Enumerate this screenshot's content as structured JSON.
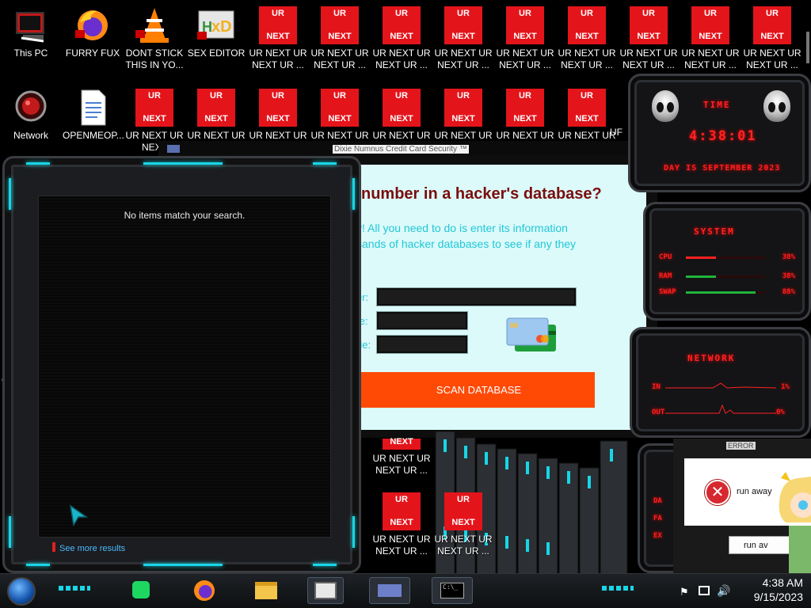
{
  "desktop": {
    "top_icons": [
      {
        "label": "This PC",
        "icon": "computer-icon"
      },
      {
        "label": "FURRY FUX",
        "icon": "firefox-icon"
      },
      {
        "label": "DONT STICK\nTHIS IN YO...",
        "icon": "vlc-cone-icon"
      },
      {
        "label": "SEX EDITOR",
        "icon": "hxd-editor-icon"
      }
    ],
    "second_icons": [
      {
        "label": "Network",
        "icon": "network-icon"
      },
      {
        "label": "OPENMEOP...",
        "icon": "document-icon"
      }
    ],
    "ur_tile": {
      "top": "UR",
      "bottom": "NEXT"
    },
    "ur_label_row1": "UR NEXT UR\nNEXT UR ...",
    "ur_label_row2": "UR NEXT UR",
    "ur_label_clip1": "UR NEXT UR\nNEXT",
    "ur_label_partial": "UF",
    "peek_left_1": "C",
    "peek_left_2": "C\nH"
  },
  "search_panel": {
    "empty_message": "No items match your search.",
    "see_more": "See more results"
  },
  "security_window": {
    "title": "Dixie Numnus Credit Card Security ™",
    "heading": "number in a hacker's database?",
    "body_line1": "v! All you need to do is enter its information",
    "body_line2": "sands of hacker databases to see if any they",
    "field_labels": [
      "er:",
      "te:",
      "de:"
    ],
    "scan_button": "SCAN DATABASE"
  },
  "widgets": {
    "time": {
      "title": "TIME",
      "clock": "4:38:01",
      "day": "DAY IS SEPTEMBER 2023"
    },
    "system": {
      "title": "SYSTEM",
      "rows": [
        {
          "label": "CPU",
          "value": "38%",
          "fraction": 0.38
        },
        {
          "label": "RAM",
          "value": "38%",
          "fraction": 0.38
        },
        {
          "label": "SWAP",
          "value": "88%",
          "fraction": 0.88
        }
      ]
    },
    "network": {
      "title": "NETWORK",
      "in_label": "IN",
      "in_value": "1%",
      "out_label": "OUT",
      "out_value": "0%"
    },
    "extra_labels": [
      "DA",
      "FA",
      "EX"
    ],
    "accent_red": "#ff2020",
    "accent_cyan": "#17d6e6"
  },
  "error_dialog": {
    "title": "ERROR",
    "message": "run away",
    "button": "run av"
  },
  "taskbar": {
    "apps": [
      "start-orb",
      "spotify-icon",
      "firefox-icon",
      "file-explorer-icon",
      "terminal-window-icon",
      "cmd-icon"
    ],
    "clock_time": "4:38 AM",
    "clock_date": "9/15/2023"
  }
}
